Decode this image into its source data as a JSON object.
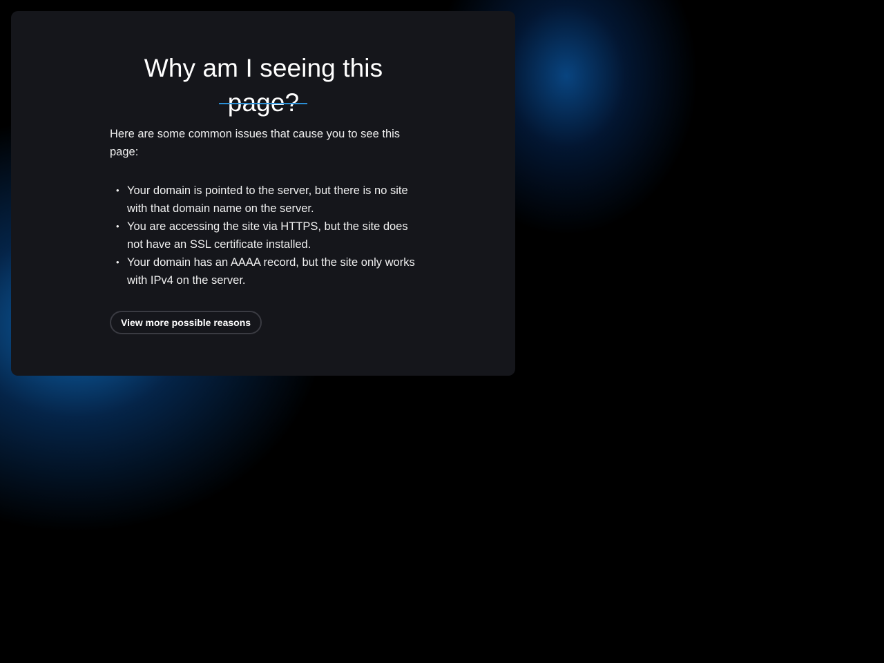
{
  "card": {
    "title": "Why am I seeing this page?",
    "intro": "Here are some common issues that cause you to see this page:",
    "issues": [
      {
        "bullet": "•",
        "text": "Your domain is pointed to the server, but there is no site with that domain name on the server."
      },
      {
        "bullet": "•",
        "text": "You are accessing the site via HTTPS, but the site does not have an SSL certificate installed."
      },
      {
        "bullet": "•",
        "text": "Your domain has an AAAA record, but the site only works with IPv4 on the server."
      }
    ],
    "more_button_label": "View more possible reasons"
  },
  "colors": {
    "background": "#000000",
    "card_background": "#15161b",
    "accent": "#2b8fd6",
    "text": "#ffffff",
    "button_border": "#3a3b42"
  }
}
